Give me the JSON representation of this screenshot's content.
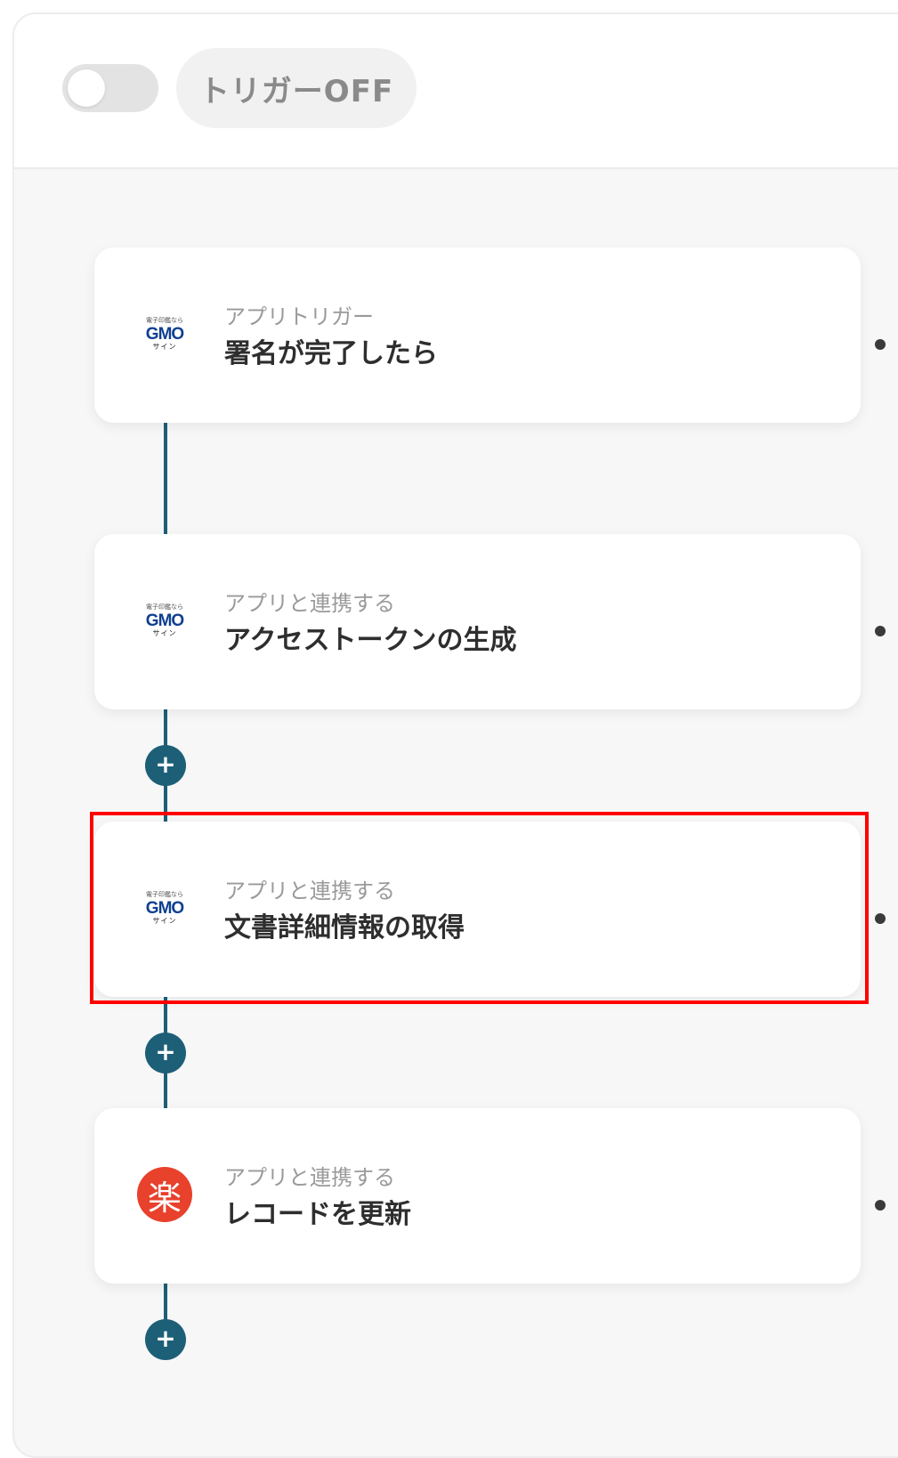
{
  "header": {
    "toggle_state": "off",
    "trigger_label": "トリガーOFF"
  },
  "flow": {
    "steps": [
      {
        "category": "アプリトリガー",
        "title": "署名が完了したら",
        "app_icon": "gmo-sign-logo"
      },
      {
        "category": "アプリと連携する",
        "title": "アクセストークンの生成",
        "app_icon": "gmo-sign-logo"
      },
      {
        "category": "アプリと連携する",
        "title": "文書詳細情報の取得",
        "app_icon": "gmo-sign-logo",
        "highlighted": true
      },
      {
        "category": "アプリと連携する",
        "title": "レコードを更新",
        "app_icon": "rakuraku-logo"
      }
    ],
    "add_button_label": "+"
  },
  "logos": {
    "gmo_top": "電子印鑑なら",
    "gmo_main": "GMO",
    "gmo_sub": "サイン",
    "raku": "楽"
  },
  "colors": {
    "accent": "#1d5f77",
    "highlight_border": "#ff0000",
    "raku_red": "#e8412c",
    "gmo_blue": "#0f3f91"
  }
}
